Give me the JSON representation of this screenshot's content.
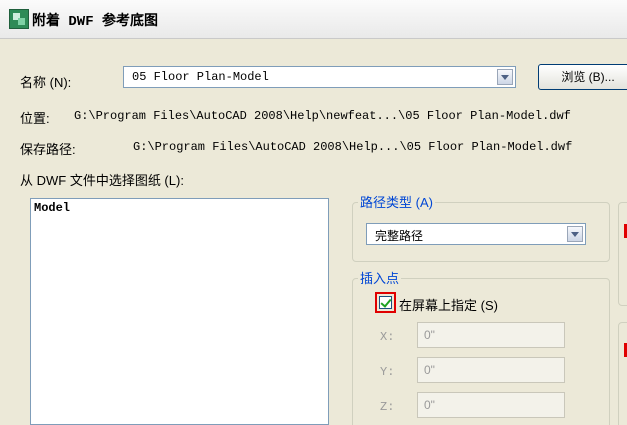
{
  "window": {
    "title": "附着 DWF 参考底图"
  },
  "name_row": {
    "label": "名称 (N):",
    "value": "05 Floor Plan-Model",
    "browse_label": "浏览 (B)..."
  },
  "location": {
    "label": "位置:",
    "path": "G:\\Program Files\\AutoCAD 2008\\Help\\newfeat...\\05 Floor Plan-Model.dwf"
  },
  "saved_path": {
    "label": "保存路径:",
    "path": "G:\\Program Files\\AutoCAD 2008\\Help...\\05 Floor Plan-Model.dwf"
  },
  "sheet_select": {
    "label": "从 DWF 文件中选择图纸 (L):",
    "items": [
      "Model"
    ]
  },
  "path_type": {
    "group_label": "路径类型 (A)",
    "value": "完整路径"
  },
  "insertion_point": {
    "group_label": "插入点",
    "specify_on_screen_label": "在屏幕上指定 (S)",
    "specify_on_screen_checked": true,
    "x_label": "X:",
    "x_value": "0\"",
    "y_label": "Y:",
    "y_value": "0\"",
    "z_label": "Z:",
    "z_value": "0\""
  },
  "colors": {
    "accent_blue": "#0046d5",
    "highlight_red": "#e00000",
    "check_green": "#21a121"
  }
}
